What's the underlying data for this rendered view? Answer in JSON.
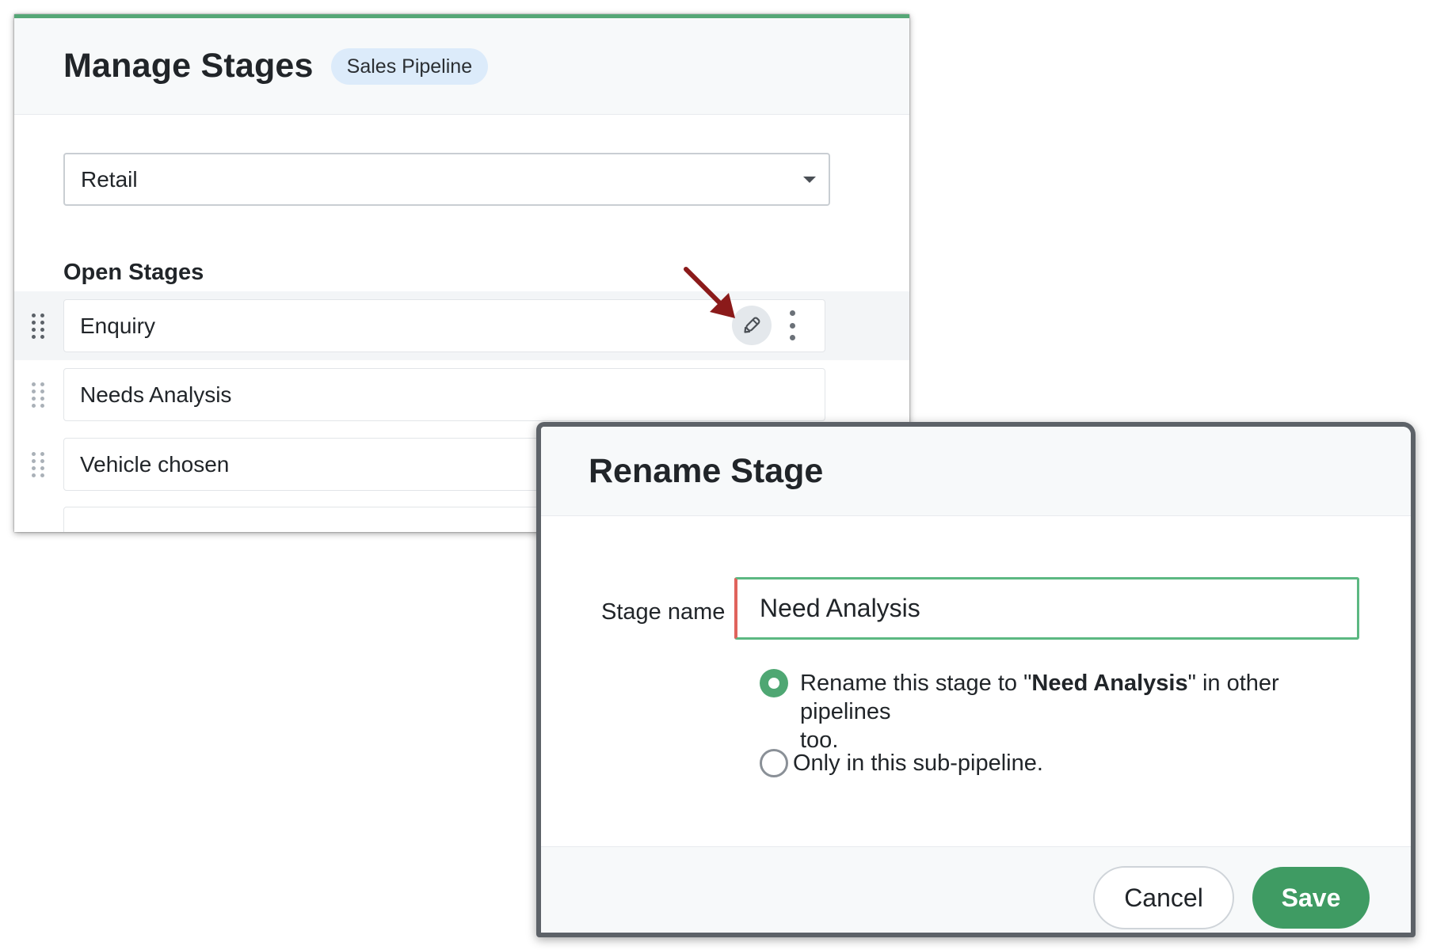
{
  "manage_stages": {
    "title": "Manage Stages",
    "pipeline_badge": "Sales Pipeline",
    "sub_pipeline_select": {
      "value": "Retail"
    },
    "section_title": "Open Stages",
    "stages": [
      {
        "label": "Enquiry"
      },
      {
        "label": "Needs Analysis"
      },
      {
        "label": "Vehicle chosen"
      }
    ]
  },
  "rename_dialog": {
    "title": "Rename Stage",
    "field_label": "Stage name",
    "input_value": "Need Analysis",
    "option_all": {
      "prefix": "Rename this stage to \"",
      "name": "Need Analysis",
      "suffix_line1": "\" in other pipelines",
      "suffix_line2": "too.",
      "checked": true
    },
    "option_sub": {
      "label": "Only in this sub-pipeline.",
      "checked": false
    },
    "cancel_label": "Cancel",
    "save_label": "Save"
  },
  "colors": {
    "accent_green": "#3f9b63",
    "input_border_green": "#5cb882",
    "input_error_red": "#e0635c",
    "badge_blue": "#dcebfa",
    "arrow_red": "#8b1a1a"
  },
  "icons": [
    "drag-handle-icon",
    "pencil-edit-icon",
    "more-vertical-icon",
    "caret-down-icon",
    "red-pointer-arrow"
  ]
}
